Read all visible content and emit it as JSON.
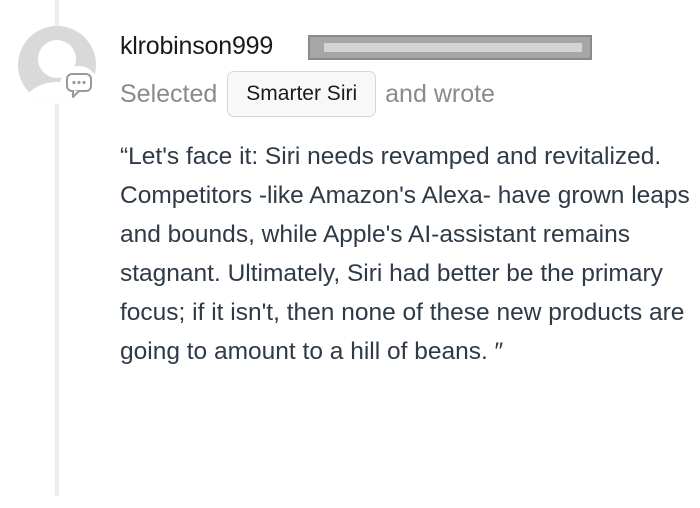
{
  "post": {
    "username": "klrobinson999",
    "action_prefix": "Selected",
    "selected_option": "Smarter Siri",
    "action_suffix": "and wrote",
    "quote": "“Let's face it: Siri needs revamped and revitalized. Competitors -like Amazon's Alexa- have grown leaps and bounds, while Apple's AI-assistant remains stagnant. Ultimately, Siri had better be the primary focus; if it isn't, then none of these new products are going to amount to a hill of beans. ″"
  },
  "icons": {
    "avatar": "default-user-avatar",
    "badge": "comment-bubble-icon"
  },
  "colors": {
    "username": "#1a1a1a",
    "muted_text": "#8a8a8a",
    "body_text": "#2e3a48",
    "chip_background": "#f8f8f8",
    "chip_border": "#d6d6d6",
    "avatar_gray": "#d9d9d9",
    "timeline": "#ececec",
    "redaction": "#a6a6a6"
  }
}
